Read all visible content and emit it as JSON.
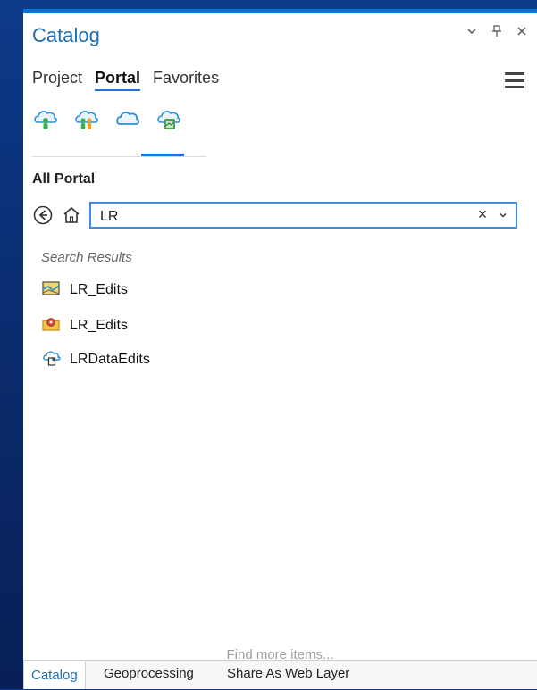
{
  "panel": {
    "title": "Catalog",
    "window_controls": {
      "menu_icon": "dropdown-icon",
      "pin_icon": "pin-icon",
      "close_icon": "close-icon"
    }
  },
  "tabs": [
    {
      "label": "Project",
      "active": false
    },
    {
      "label": "Portal",
      "active": true
    },
    {
      "label": "Favorites",
      "active": false
    }
  ],
  "menu": {
    "icon": "hamburger-icon"
  },
  "icon_row": {
    "items": [
      "my-content-icon",
      "groups-icon",
      "all-portal-icon",
      "living-atlas-icon"
    ],
    "selected_index": 2
  },
  "section": {
    "label": "All Portal"
  },
  "search": {
    "value": "LR",
    "placeholder": ""
  },
  "results": {
    "heading": "Search Results",
    "items": [
      {
        "label": "LR_Edits",
        "icon": "map-icon"
      },
      {
        "label": "LR_Edits",
        "icon": "feature-layer-icon"
      },
      {
        "label": "LRDataEdits",
        "icon": "service-icon"
      }
    ]
  },
  "footer": {
    "find_more": "Find more items..."
  },
  "bottom_tabs": [
    {
      "label": "Catalog",
      "active": true
    },
    {
      "label": "Geoprocessing",
      "active": false
    },
    {
      "label": "Share As Web Layer",
      "active": false
    }
  ],
  "colors": {
    "accent": "#1f6fb2",
    "underline": "#1b78d0",
    "border_blue": "#3a8fdc",
    "muted_text": "#a0a0a0"
  }
}
